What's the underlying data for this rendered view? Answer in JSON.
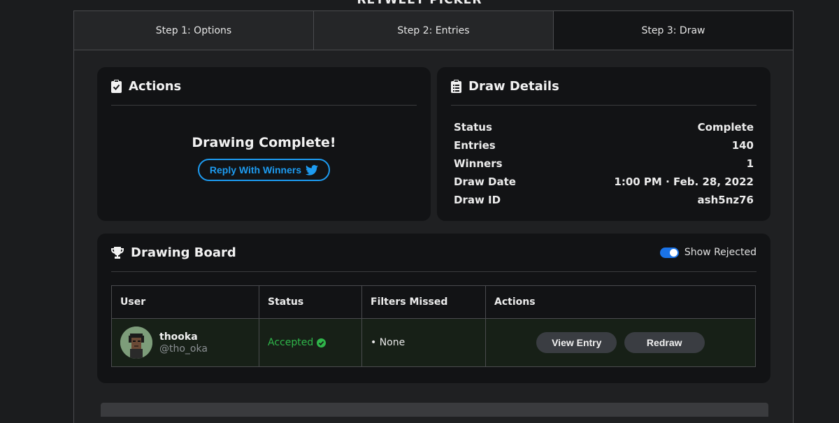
{
  "page": {
    "title": "RETWEET PICKER"
  },
  "tabs": [
    {
      "label": "Step 1: Options",
      "active": false
    },
    {
      "label": "Step 2: Entries",
      "active": false
    },
    {
      "label": "Step 3: Draw",
      "active": true
    }
  ],
  "actions": {
    "title": "Actions",
    "message": "Drawing Complete!",
    "reply_label": "Reply With Winners"
  },
  "details": {
    "title": "Draw Details",
    "rows": [
      {
        "label": "Status",
        "value": "Complete"
      },
      {
        "label": "Entries",
        "value": "140"
      },
      {
        "label": "Winners",
        "value": "1"
      },
      {
        "label": "Draw Date",
        "value": "1:00 PM · Feb. 28, 2022"
      },
      {
        "label": "Draw ID",
        "value": "ash5nz76"
      }
    ]
  },
  "board": {
    "title": "Drawing Board",
    "toggle_label": "Show Rejected",
    "toggle_on": true,
    "columns": [
      "User",
      "Status",
      "Filters Missed",
      "Actions"
    ],
    "rows": [
      {
        "name": "thooka",
        "handle": "@tho_oka",
        "status": "Accepted",
        "filters": "• None",
        "view_label": "View Entry",
        "redraw_label": "Redraw"
      }
    ]
  },
  "colors": {
    "accent": "#1d9bf0",
    "accepted": "#2fb54a",
    "toggle": "#1a73e8"
  }
}
